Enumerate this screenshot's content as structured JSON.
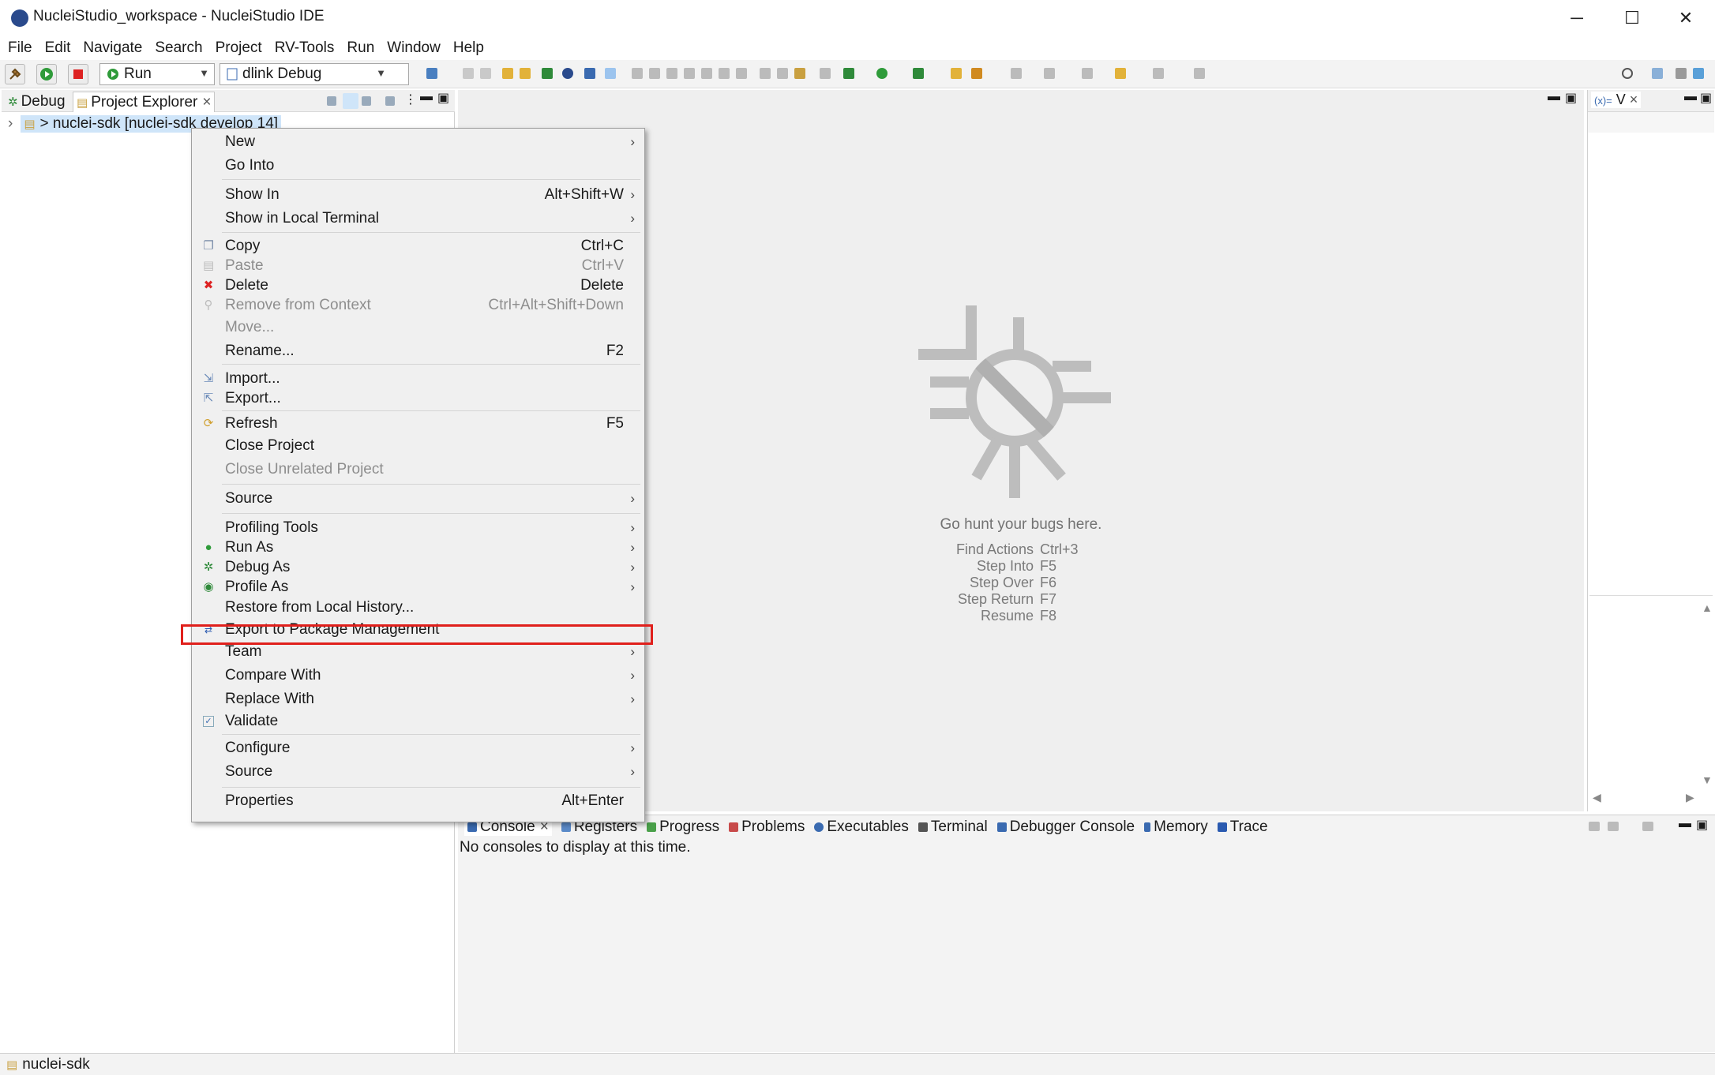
{
  "window": {
    "title": "NucleiStudio_workspace - NucleiStudio IDE",
    "minimize": "─",
    "maximize": "☐",
    "close": "✕"
  },
  "menubar": [
    "File",
    "Edit",
    "Navigate",
    "Search",
    "Project",
    "RV-Tools",
    "Run",
    "Window",
    "Help"
  ],
  "toolbar": {
    "launch_mode": "Run",
    "launch_config": "dlink Debug"
  },
  "left_panel": {
    "tabs": [
      {
        "label": "Debug"
      },
      {
        "label": "Project Explorer",
        "close": "×"
      }
    ],
    "tree_item": "> nuclei-sdk [nuclei-sdk develop 14]",
    "tree_arrow": "›"
  },
  "context_menu": {
    "items": [
      {
        "label": "New",
        "shortcut": "",
        "submenu": true
      },
      {
        "label": "Go Into",
        "shortcut": ""
      },
      {
        "label": "Show In",
        "shortcut": "Alt+Shift+W",
        "submenu": true
      },
      {
        "label": "Show in Local Terminal",
        "shortcut": "",
        "submenu": true
      },
      {
        "label": "Copy",
        "shortcut": "Ctrl+C"
      },
      {
        "label": "Paste",
        "shortcut": "Ctrl+V",
        "disabled": true
      },
      {
        "label": "Delete",
        "shortcut": "Delete"
      },
      {
        "label": "Remove from Context",
        "shortcut": "Ctrl+Alt+Shift+Down",
        "disabled": true
      },
      {
        "label": "Move...",
        "shortcut": "",
        "disabled": true
      },
      {
        "label": "Rename...",
        "shortcut": "F2"
      },
      {
        "label": "Import...",
        "shortcut": ""
      },
      {
        "label": "Export...",
        "shortcut": ""
      },
      {
        "label": "Refresh",
        "shortcut": "F5"
      },
      {
        "label": "Close Project",
        "shortcut": ""
      },
      {
        "label": "Close Unrelated Project",
        "shortcut": "",
        "disabled": true
      },
      {
        "label": "Source",
        "shortcut": "",
        "submenu": true
      },
      {
        "label": "Profiling Tools",
        "shortcut": "",
        "submenu": true
      },
      {
        "label": "Run As",
        "shortcut": "",
        "submenu": true
      },
      {
        "label": "Debug As",
        "shortcut": "",
        "submenu": true
      },
      {
        "label": "Profile As",
        "shortcut": "",
        "submenu": true
      },
      {
        "label": "Restore from Local History...",
        "shortcut": ""
      },
      {
        "label": "Export to Package Management",
        "shortcut": ""
      },
      {
        "label": "Team",
        "shortcut": "",
        "submenu": true
      },
      {
        "label": "Compare With",
        "shortcut": "",
        "submenu": true
      },
      {
        "label": "Replace With",
        "shortcut": "",
        "submenu": true
      },
      {
        "label": "Validate",
        "shortcut": ""
      },
      {
        "label": "Configure",
        "shortcut": "",
        "submenu": true
      },
      {
        "label": "Source",
        "shortcut": "",
        "submenu": true
      },
      {
        "label": "Properties",
        "shortcut": "Alt+Enter"
      }
    ],
    "submenu_arrow": "›"
  },
  "editor_hint": {
    "headline": "Go hunt your bugs here.",
    "shortcuts": [
      {
        "action": "Find Actions",
        "key": "Ctrl+3"
      },
      {
        "action": "Step Into",
        "key": "F5"
      },
      {
        "action": "Step Over",
        "key": "F6"
      },
      {
        "action": "Step Return",
        "key": "F7"
      },
      {
        "action": "Resume",
        "key": "F8"
      }
    ]
  },
  "console": {
    "tabs": [
      "Console",
      "Registers",
      "Progress",
      "Problems",
      "Executables",
      "Terminal",
      "Debugger Console",
      "Memory",
      "Trace"
    ],
    "close": "×",
    "message": "No consoles to display at this time."
  },
  "right_panel": {
    "tab_label": "V",
    "close": "×"
  },
  "statusbar": {
    "text": "nuclei-sdk"
  },
  "colors": {
    "highlight_border": "#e0201c",
    "selection": "#cfe5f9"
  }
}
